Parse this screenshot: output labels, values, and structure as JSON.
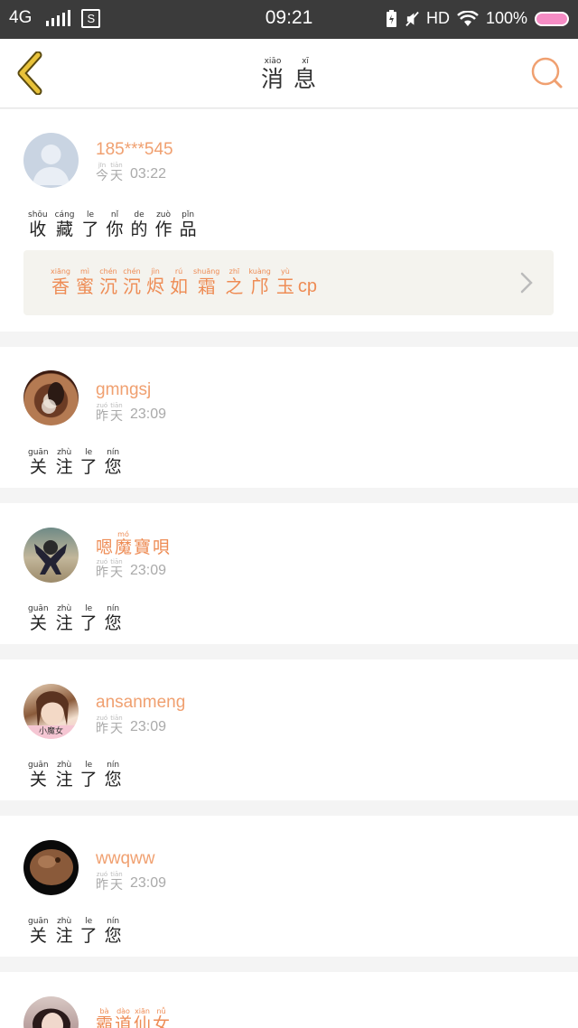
{
  "status_bar": {
    "network": "4G",
    "sim_icon": "S",
    "time": "09:21",
    "hd": "HD",
    "battery": "100%"
  },
  "header": {
    "back_icon": "chevron-left-icon",
    "search_icon": "search-icon",
    "title": [
      {
        "pinyin": "xiāo",
        "hanzi": "消"
      },
      {
        "pinyin": "xī",
        "hanzi": "息"
      }
    ]
  },
  "messages": [
    {
      "username": "185***545",
      "day": [
        {
          "pinyin": "jīn",
          "hanzi": "今"
        },
        {
          "pinyin": "tiān",
          "hanzi": "天"
        }
      ],
      "time": "03:22",
      "action": [
        {
          "pinyin": "shōu",
          "hanzi": "收"
        },
        {
          "pinyin": "cáng",
          "hanzi": "藏"
        },
        {
          "pinyin": "le",
          "hanzi": "了"
        },
        {
          "pinyin": "nǐ",
          "hanzi": "你"
        },
        {
          "pinyin": "de",
          "hanzi": "的"
        },
        {
          "pinyin": "zuò",
          "hanzi": "作"
        },
        {
          "pinyin": "pǐn",
          "hanzi": "品"
        }
      ],
      "work": {
        "title": [
          {
            "pinyin": "xiāng",
            "hanzi": "香"
          },
          {
            "pinyin": "mì",
            "hanzi": "蜜"
          },
          {
            "pinyin": "chén",
            "hanzi": "沉"
          },
          {
            "pinyin": "chén",
            "hanzi": "沉"
          },
          {
            "pinyin": "jìn",
            "hanzi": "烬"
          },
          {
            "pinyin": "rú",
            "hanzi": "如"
          },
          {
            "pinyin": "shuāng",
            "hanzi": "霜"
          },
          {
            "pinyin": "zhī",
            "hanzi": "之"
          },
          {
            "pinyin": "kuàng",
            "hanzi": "邝"
          },
          {
            "pinyin": "yù",
            "hanzi": "玉"
          }
        ],
        "suffix": "cp"
      }
    },
    {
      "username": "gmngsj",
      "day": [
        {
          "pinyin": "zuó",
          "hanzi": "昨"
        },
        {
          "pinyin": "tiān",
          "hanzi": "天"
        }
      ],
      "time": "23:09",
      "action": [
        {
          "pinyin": "guān",
          "hanzi": "关"
        },
        {
          "pinyin": "zhù",
          "hanzi": "注"
        },
        {
          "pinyin": "le",
          "hanzi": "了"
        },
        {
          "pinyin": "nín",
          "hanzi": "您"
        }
      ]
    },
    {
      "username_chars": [
        {
          "pinyin": "",
          "hanzi": "嗯"
        },
        {
          "pinyin": "mó",
          "hanzi": "魔"
        },
        {
          "pinyin": "",
          "hanzi": "寶"
        },
        {
          "pinyin": "",
          "hanzi": "唄"
        }
      ],
      "day": [
        {
          "pinyin": "zuó",
          "hanzi": "昨"
        },
        {
          "pinyin": "tiān",
          "hanzi": "天"
        }
      ],
      "time": "23:09",
      "action": [
        {
          "pinyin": "guān",
          "hanzi": "关"
        },
        {
          "pinyin": "zhù",
          "hanzi": "注"
        },
        {
          "pinyin": "le",
          "hanzi": "了"
        },
        {
          "pinyin": "nín",
          "hanzi": "您"
        }
      ]
    },
    {
      "username": "ansanmeng",
      "avatar_caption": "小魔女",
      "day": [
        {
          "pinyin": "zuó",
          "hanzi": "昨"
        },
        {
          "pinyin": "tiān",
          "hanzi": "天"
        }
      ],
      "time": "23:09",
      "action": [
        {
          "pinyin": "guān",
          "hanzi": "关"
        },
        {
          "pinyin": "zhù",
          "hanzi": "注"
        },
        {
          "pinyin": "le",
          "hanzi": "了"
        },
        {
          "pinyin": "nín",
          "hanzi": "您"
        }
      ]
    },
    {
      "username": "wwqww",
      "day": [
        {
          "pinyin": "zuó",
          "hanzi": "昨"
        },
        {
          "pinyin": "tiān",
          "hanzi": "天"
        }
      ],
      "time": "23:09",
      "action": [
        {
          "pinyin": "guān",
          "hanzi": "关"
        },
        {
          "pinyin": "zhù",
          "hanzi": "注"
        },
        {
          "pinyin": "le",
          "hanzi": "了"
        },
        {
          "pinyin": "nín",
          "hanzi": "您"
        }
      ]
    },
    {
      "username_chars": [
        {
          "pinyin": "bà",
          "hanzi": "霸"
        },
        {
          "pinyin": "dào",
          "hanzi": "道"
        },
        {
          "pinyin": "xiān",
          "hanzi": "仙"
        },
        {
          "pinyin": "nǚ",
          "hanzi": "女"
        }
      ]
    }
  ],
  "colors": {
    "accent": "#ee8c55",
    "status_bar": "#3b3b3b",
    "back_icon": "#e8c23a",
    "search_icon": "#f0a070"
  }
}
